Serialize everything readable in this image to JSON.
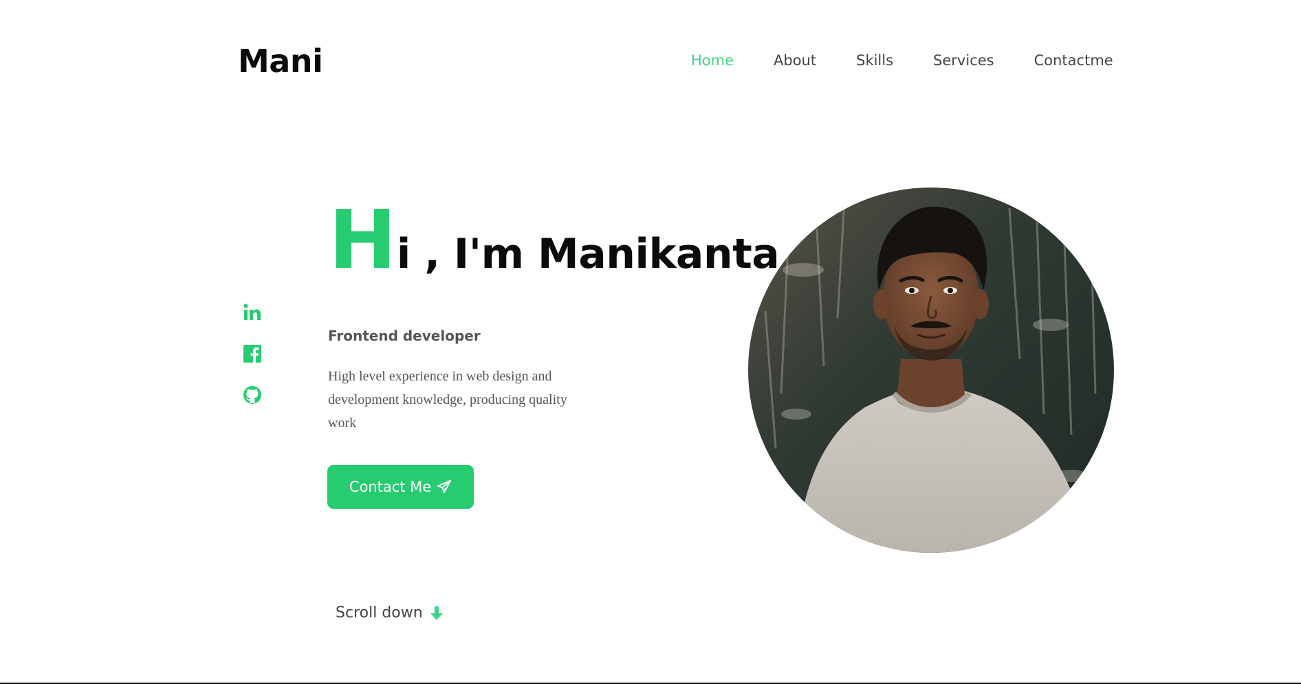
{
  "brand": {
    "logo_text": "Mani"
  },
  "nav": {
    "items": [
      {
        "label": "Home",
        "active": true
      },
      {
        "label": "About",
        "active": false
      },
      {
        "label": "Skills",
        "active": false
      },
      {
        "label": "Services",
        "active": false
      },
      {
        "label": "Contactme",
        "active": false
      }
    ]
  },
  "social": {
    "icons": [
      "linkedin-icon",
      "facebook-icon",
      "github-icon"
    ]
  },
  "hero": {
    "title_initial": "H",
    "title_rest": "i , I'm Manikanta",
    "role": "Frontend developer",
    "description": "High level experience in web design and development knowledge, producing quality work",
    "contact_button_label": "Contact Me",
    "contact_button_icon": "paper-plane-icon",
    "scroll_label": "Scroll down",
    "scroll_icon": "arrow-down-icon"
  },
  "portrait": {
    "description_icon": "profile-photo"
  },
  "colors": {
    "accent": "#27cc71",
    "nav_active": "#3dd584",
    "text_dark": "#0b0b0b",
    "text_muted": "#555555"
  }
}
